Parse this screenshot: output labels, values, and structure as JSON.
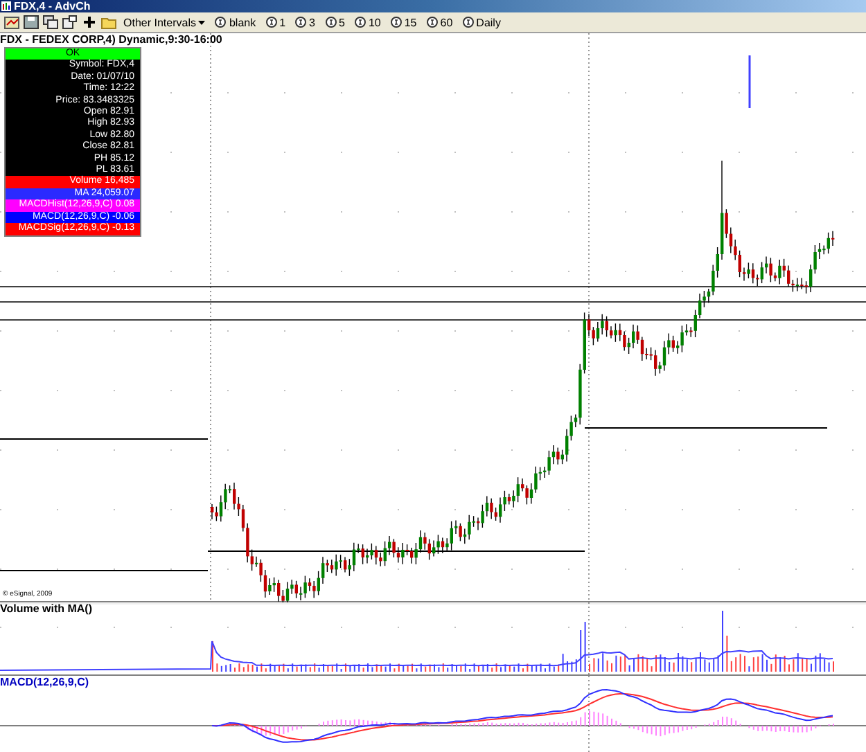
{
  "window": {
    "title": "FDX,4 - AdvCh"
  },
  "toolbar": {
    "menu": "Other Intervals",
    "intervals": [
      {
        "label": "blank"
      },
      {
        "label": "1"
      },
      {
        "label": "3"
      },
      {
        "label": "5"
      },
      {
        "label": "10"
      },
      {
        "label": "15"
      },
      {
        "label": "60"
      },
      {
        "label": "Daily"
      }
    ]
  },
  "chart": {
    "title": "FDX - FEDEX CORP,4) Dynamic,9:30-16:00",
    "copyright": "© eSignal, 2009"
  },
  "cursor_window": {
    "rows": [
      {
        "text": "OK",
        "color": "#00ff00"
      },
      {
        "text": "Symbol: FDX,4",
        "color": "#000000"
      },
      {
        "text": "Date: 01/07/10",
        "color": "#000000"
      },
      {
        "text": "Time: 12:22",
        "color": "#000000"
      },
      {
        "text": "Price: 83.3483325",
        "color": "#000000"
      },
      {
        "text": "Open 82.91",
        "color": "#000000"
      },
      {
        "text": "High 82.93",
        "color": "#000000"
      },
      {
        "text": "Low 82.80",
        "color": "#000000"
      },
      {
        "text": "Close 82.81",
        "color": "#000000"
      },
      {
        "text": "PH 85.12",
        "color": "#000000"
      },
      {
        "text": "PL 83.61",
        "color": "#000000"
      },
      {
        "text": "Volume 16,485",
        "color": "#ff0000"
      },
      {
        "text": "MA 24,059.07",
        "color": "#2a2aff"
      },
      {
        "text": "MACDHist(12,26,9,C) 0.08",
        "color": "#ff00ff"
      },
      {
        "text": "MACD(12,26,9,C) -0.06",
        "color": "#0000ff"
      },
      {
        "text": "MACDSig(12,26,9,C) -0.13",
        "color": "#ff0000"
      }
    ]
  },
  "volume_panel": {
    "title": "Volume with MA()"
  },
  "macd_panel": {
    "title": "MACD(12,26,9,C)"
  }
}
